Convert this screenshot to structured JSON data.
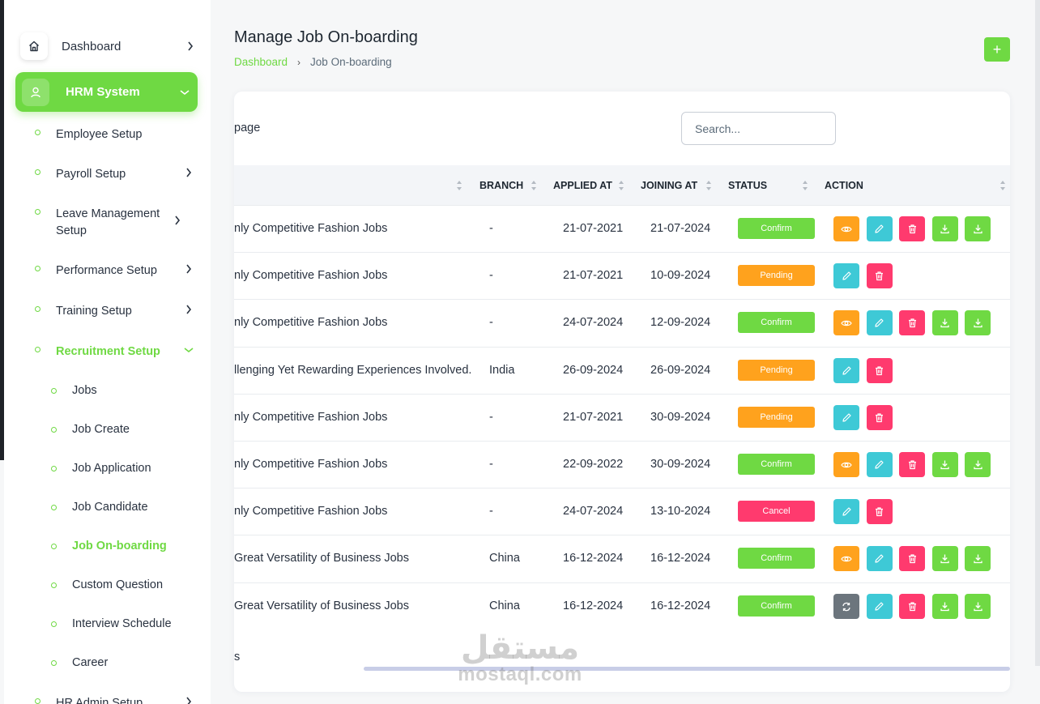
{
  "sidebar": {
    "dashboard_label": "Dashboard",
    "hrm_label": "HRM System",
    "items": [
      {
        "label": "Employee Setup",
        "chevron": false
      },
      {
        "label": "Payroll Setup",
        "chevron": true
      },
      {
        "label": "Leave Management Setup",
        "chevron": true
      },
      {
        "label": "Performance Setup",
        "chevron": true
      },
      {
        "label": "Training Setup",
        "chevron": true
      },
      {
        "label": "Recruitment Setup",
        "chevron": true,
        "active": true
      }
    ],
    "recruitment_items": [
      "Jobs",
      "Job Create",
      "Job Application",
      "Job Candidate",
      "Job On-boarding",
      "Custom Question",
      "Interview Schedule",
      "Career"
    ],
    "active_recruitment_item": "Job On-boarding",
    "bottom_item": "HR Admin Setup"
  },
  "header": {
    "title": "Manage Job On-boarding",
    "breadcrumb_home": "Dashboard",
    "breadcrumb_current": "Job On-boarding",
    "add_label": "+"
  },
  "table": {
    "entries_label": "page",
    "search_placeholder": "Search...",
    "columns": [
      "BRANCH",
      "APPLIED AT",
      "JOINING AT",
      "STATUS",
      "ACTION"
    ],
    "rows": [
      {
        "job": "nly Competitive Fashion Jobs",
        "branch": "-",
        "applied": "21-07-2021",
        "joining": "21-07-2024",
        "status": "Confirm",
        "actions": [
          "view",
          "edit",
          "delete",
          "download",
          "download"
        ]
      },
      {
        "job": "nly Competitive Fashion Jobs",
        "branch": "-",
        "applied": "21-07-2021",
        "joining": "10-09-2024",
        "status": "Pending",
        "actions": [
          "edit",
          "delete"
        ]
      },
      {
        "job": "nly Competitive Fashion Jobs",
        "branch": "-",
        "applied": "24-07-2024",
        "joining": "12-09-2024",
        "status": "Confirm",
        "actions": [
          "view",
          "edit",
          "delete",
          "download",
          "download"
        ]
      },
      {
        "job": "llenging Yet Rewarding Experiences Involved.",
        "branch": "India",
        "applied": "26-09-2024",
        "joining": "26-09-2024",
        "status": "Pending",
        "actions": [
          "edit",
          "delete"
        ]
      },
      {
        "job": "nly Competitive Fashion Jobs",
        "branch": "-",
        "applied": "21-07-2021",
        "joining": "30-09-2024",
        "status": "Pending",
        "actions": [
          "edit",
          "delete"
        ]
      },
      {
        "job": "nly Competitive Fashion Jobs",
        "branch": "-",
        "applied": "22-09-2022",
        "joining": "30-09-2024",
        "status": "Confirm",
        "actions": [
          "view",
          "edit",
          "delete",
          "download",
          "download"
        ]
      },
      {
        "job": "nly Competitive Fashion Jobs",
        "branch": "-",
        "applied": "24-07-2024",
        "joining": "13-10-2024",
        "status": "Cancel",
        "actions": [
          "edit",
          "delete"
        ]
      },
      {
        "job": "Great Versatility of Business Jobs",
        "branch": "China",
        "applied": "16-12-2024",
        "joining": "16-12-2024",
        "status": "Confirm",
        "actions": [
          "view",
          "edit",
          "delete",
          "download",
          "download"
        ]
      },
      {
        "job": "Great Versatility of Business Jobs",
        "branch": "China",
        "applied": "16-12-2024",
        "joining": "16-12-2024",
        "status": "Confirm",
        "actions": [
          "convert",
          "edit",
          "delete",
          "download",
          "download"
        ]
      }
    ],
    "footer_text": "s"
  },
  "watermark": {
    "arabic": "مستقل",
    "latin": "mostaql.com"
  },
  "colors": {
    "primary": "#6fd943",
    "warning": "#ffa21d",
    "info": "#3ec9d6",
    "danger": "#ff3a6e",
    "secondary": "#6c757d"
  },
  "icons": {
    "view": "eye-icon",
    "edit": "pencil-icon",
    "delete": "trash-icon",
    "download": "download-icon",
    "convert": "convert-icon"
  }
}
